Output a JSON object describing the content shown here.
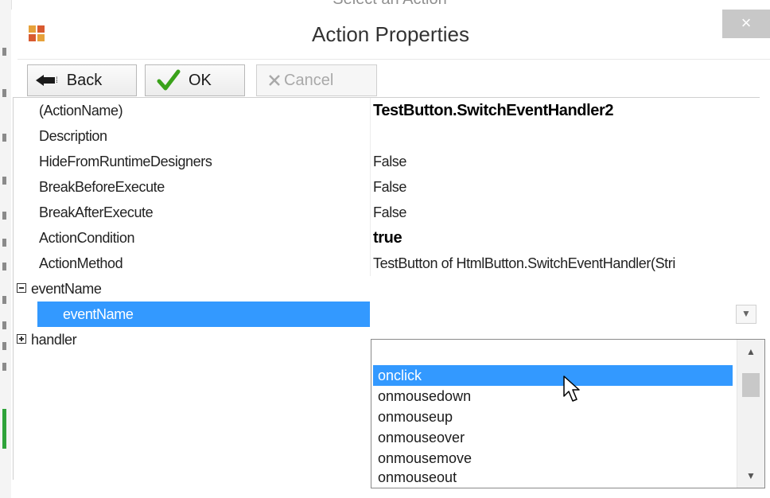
{
  "background": {
    "dialog_title": "Select an Action"
  },
  "window": {
    "title": "Action Properties",
    "close_label": "×"
  },
  "toolbar": {
    "back_label": "Back",
    "ok_label": "OK",
    "cancel_label": "Cancel"
  },
  "properties": {
    "action_name": {
      "name": "(ActionName)",
      "value": "TestButton.SwitchEventHandler2"
    },
    "description": {
      "name": "Description",
      "value": ""
    },
    "hide_from_runtime": {
      "name": "HideFromRuntimeDesigners",
      "value": "False"
    },
    "break_before": {
      "name": "BreakBeforeExecute",
      "value": "False"
    },
    "break_after": {
      "name": "BreakAfterExecute",
      "value": "False"
    },
    "action_condition": {
      "name": "ActionCondition",
      "value": "true"
    },
    "action_method": {
      "name": "ActionMethod",
      "value": "TestButton of HtmlButton.SwitchEventHandler(Stri"
    },
    "event_name_category": {
      "name": "eventName",
      "expanded": true
    },
    "event_name_param": {
      "name": "eventName",
      "value": ""
    },
    "handler_category": {
      "name": "handler",
      "expanded": false
    }
  },
  "dropdown": {
    "items": [
      "onclick",
      "onmousedown",
      "onmouseup",
      "onmouseover",
      "onmousemove",
      "onmouseout"
    ],
    "selected": "onclick"
  },
  "colors": {
    "selection": "#3399ff",
    "ok_check": "#3aa21a"
  },
  "icons": {
    "app": "app-icon",
    "back": "back-arrow-icon",
    "ok": "checkmark-icon",
    "cancel": "cross-icon",
    "dropdown": "chevron-down-icon",
    "cursor": "mouse-pointer-icon"
  }
}
